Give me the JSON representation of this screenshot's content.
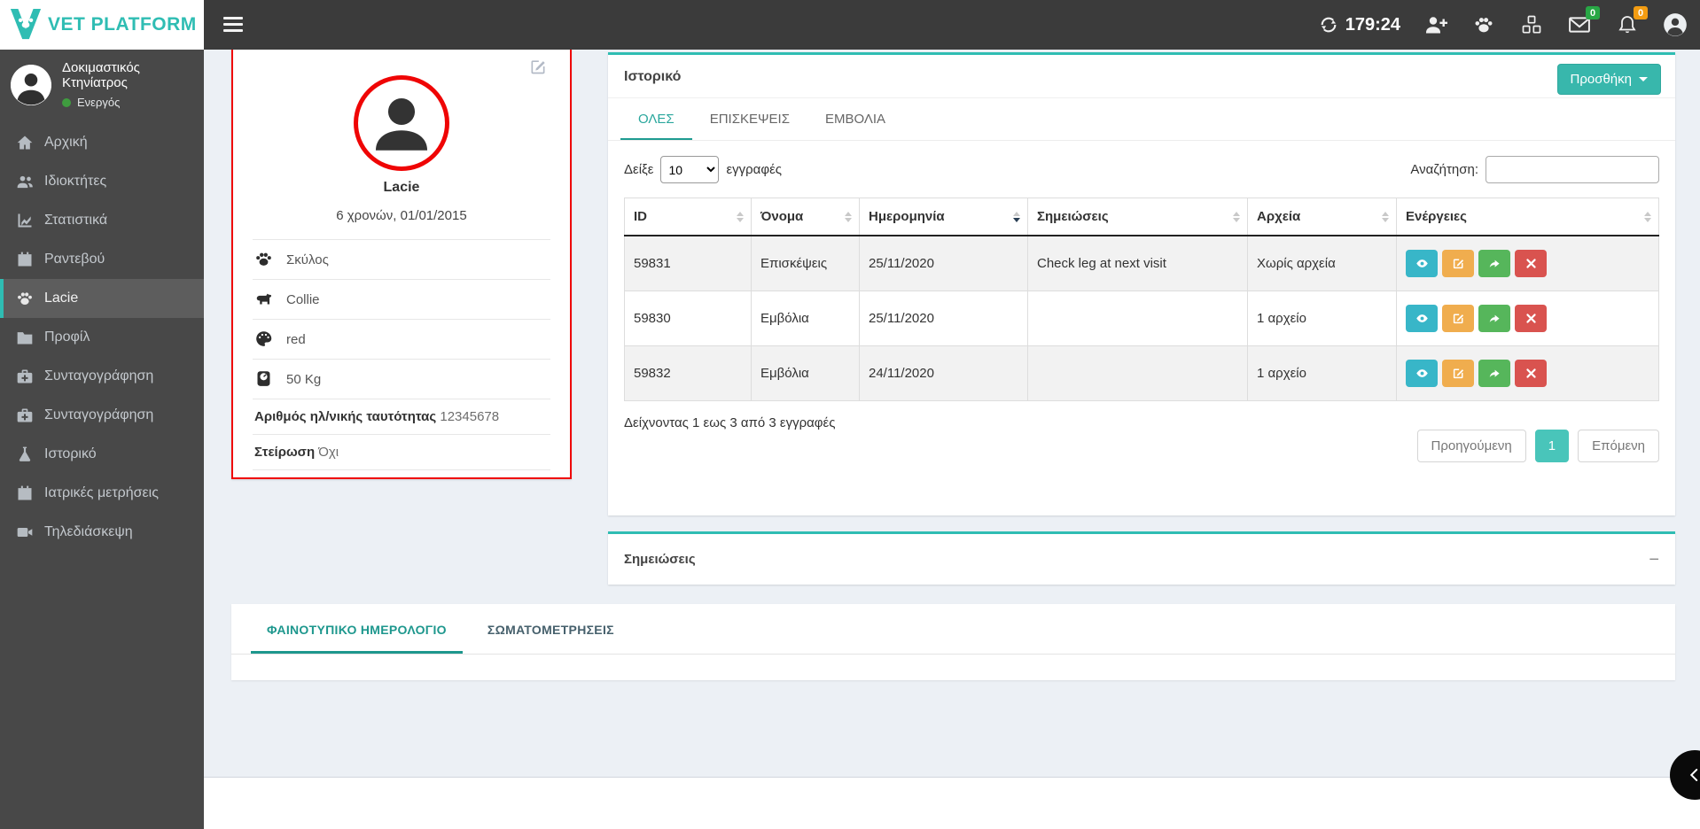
{
  "topbar": {
    "brand": "VET PLATFORM",
    "timer": "179:24",
    "mail_badge": "0",
    "notifications_badge": "0"
  },
  "sidebar": {
    "user": {
      "name": "Δοκιμαστικός Κτηνίατρος",
      "status": "Ενεργός"
    },
    "items": [
      {
        "label": "Αρχική"
      },
      {
        "label": "Ιδιοκτήτες"
      },
      {
        "label": "Στατιστικά"
      },
      {
        "label": "Ραντεβού"
      },
      {
        "label": "Lacie"
      },
      {
        "label": "Προφίλ"
      },
      {
        "label": "Συνταγογράφηση"
      },
      {
        "label": "Συνταγογράφηση"
      },
      {
        "label": "Ιστορικό"
      },
      {
        "label": "Ιατρικές μετρήσεις"
      },
      {
        "label": "Τηλεδιάσκεψη"
      }
    ]
  },
  "pet_card": {
    "name": "Lacie",
    "age": "6 χρονών, 01/01/2015",
    "species": "Σκύλος",
    "breed": "Collie",
    "color": "red",
    "weight": "50 Kg",
    "id_label": "Αριθμός ηλ/νικής ταυτότητας",
    "id_value": "12345678",
    "sterilization_label": "Στείρωση",
    "sterilization_value": "Όχι"
  },
  "history": {
    "title": "Ιστορικό",
    "add_button": "Προσθήκη",
    "tabs": [
      {
        "label": "ΟΛΕΣ"
      },
      {
        "label": "ΕΠΙΣΚΕΨΕΙΣ"
      },
      {
        "label": "ΕΜΒΟΛΙΑ"
      }
    ],
    "show_label": "Δείξε",
    "page_size": "10",
    "entries_label": "εγγραφές",
    "search_label": "Αναζήτηση:",
    "columns": [
      {
        "label": "ID"
      },
      {
        "label": "Όνομα"
      },
      {
        "label": "Ημερομηνία"
      },
      {
        "label": "Σημειώσεις"
      },
      {
        "label": "Αρχεία"
      },
      {
        "label": "Ενέργειες"
      }
    ],
    "rows": [
      {
        "id": "59831",
        "name": "Επισκέψεις",
        "date": "25/11/2020",
        "notes": "Check leg at next visit",
        "files": "Χωρίς αρχεία"
      },
      {
        "id": "59830",
        "name": "Εμβόλια",
        "date": "25/11/2020",
        "notes": "",
        "files": "1 αρχείο"
      },
      {
        "id": "59832",
        "name": "Εμβόλια",
        "date": "24/11/2020",
        "notes": "",
        "files": "1 αρχείο"
      }
    ],
    "footer_info": "Δείχνοντας 1 εως 3 από 3 εγγραφές",
    "pagination": {
      "prev": "Προηγούμενη",
      "current": "1",
      "next": "Επόμενη"
    }
  },
  "notes_panel": {
    "title": "Σημειώσεις"
  },
  "bottom_tabs": {
    "tab1": "ΦΑΙΝΟΤΥΠΙΚΟ ΗΜΕΡΟΛΟΓΙΟ",
    "tab2": "ΣΩΜΑΤΟΜΕΤΡΗΣΕΙΣ"
  },
  "colors": {
    "accent": "#2fbdb3",
    "sidebar_bg": "#484848",
    "topbar_bg": "#3b3b3b",
    "highlight_border": "#ef0505",
    "view_btn": "#38b6c8",
    "edit_btn": "#f0ad4e",
    "share_btn": "#56b65b",
    "delete_btn": "#d9534f",
    "mail_badge": "#28a745",
    "bell_badge": "#f39c12"
  }
}
